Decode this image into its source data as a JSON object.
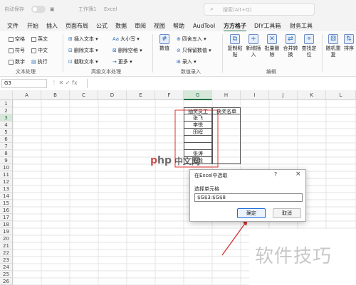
{
  "titlebar": {
    "autosave_label": "自动保存",
    "file_name": "工作簿1",
    "app_name": "Excel",
    "search_placeholder": "搜索(Alt+Q)"
  },
  "menu": {
    "tabs": [
      "文件",
      "开始",
      "插入",
      "页面布局",
      "公式",
      "数据",
      "审阅",
      "视图",
      "帮助",
      "AudTool",
      "方方格子",
      "DIY工具箱",
      "财务工具"
    ],
    "active": "方方格子"
  },
  "ribbon": {
    "text_group": {
      "checks": [
        "空格",
        "英文",
        "符号",
        "中文",
        "数字",
        "执行"
      ],
      "label": "文本处理"
    },
    "adv_text_group": {
      "items": [
        "插入文本",
        "删除文本",
        "截取文本",
        "大小写",
        "删除空格",
        "更多"
      ],
      "label": "高级文本处理"
    },
    "numeric_group": {
      "items": [
        "数值",
        "四舍五入",
        "只保留数值",
        "录入"
      ],
      "label": "数值录入"
    },
    "edit_group": {
      "items": [
        "复制粘贴",
        "新增插入",
        "批量删除",
        "合并转换",
        "查找定位"
      ],
      "label": "编辑"
    },
    "right_group": {
      "items": [
        "随机重复",
        "排序"
      ]
    }
  },
  "formula_bar": {
    "cell_ref": "G3",
    "icons": "⋮  ✕  ✓  fx",
    "value": ""
  },
  "columns": [
    "A",
    "B",
    "C",
    "D",
    "E",
    "F",
    "G",
    "H",
    "I",
    "J",
    "K",
    "L"
  ],
  "rows": [
    "1",
    "2",
    "3",
    "4",
    "5",
    "6",
    "7",
    "8",
    "9",
    "10",
    "11",
    "12",
    "13",
    "14",
    "15",
    "16",
    "17",
    "18",
    "19",
    "20",
    "21",
    "22",
    "23",
    "24",
    "25",
    "26"
  ],
  "sheet": {
    "header_g": "抽奖员工",
    "header_h": "获奖名单",
    "names": [
      "张飞",
      "李悦",
      "田程",
      "",
      "",
      "张涛",
      "石毅"
    ]
  },
  "dialog": {
    "title": "在Excel中选取",
    "help": "?",
    "close": "×",
    "label": "选择单元格",
    "input_value": "$G$3:$G$8",
    "ok": "确定",
    "cancel": "取消"
  },
  "watermarks": {
    "php_logo": "php",
    "php_cn": "中文网",
    "site_text": "软件技巧"
  },
  "colors": {
    "accent_green": "#217346",
    "selection_red": "#e03030",
    "annotation_red": "#d03030"
  }
}
